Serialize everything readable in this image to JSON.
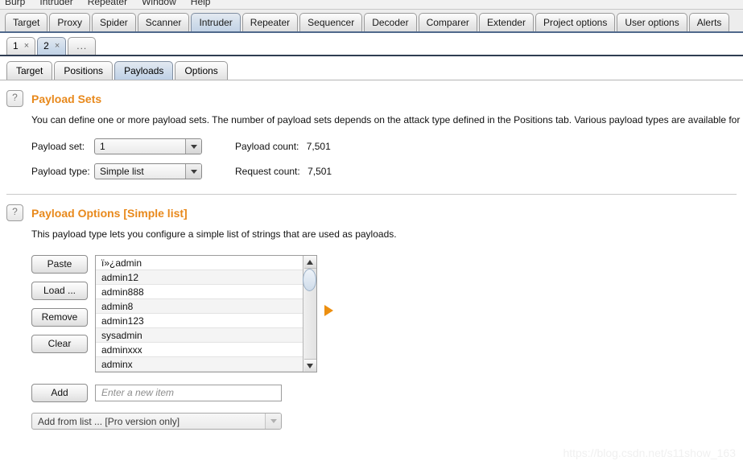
{
  "menu": {
    "items": [
      "Burp",
      "Intruder",
      "Repeater",
      "Window",
      "Help"
    ]
  },
  "main_tabs": {
    "items": [
      {
        "label": "Target",
        "active": false
      },
      {
        "label": "Proxy",
        "active": false
      },
      {
        "label": "Spider",
        "active": false
      },
      {
        "label": "Scanner",
        "active": false
      },
      {
        "label": "Intruder",
        "active": true
      },
      {
        "label": "Repeater",
        "active": false
      },
      {
        "label": "Sequencer",
        "active": false
      },
      {
        "label": "Decoder",
        "active": false
      },
      {
        "label": "Comparer",
        "active": false
      },
      {
        "label": "Extender",
        "active": false
      },
      {
        "label": "Project options",
        "active": false
      },
      {
        "label": "User options",
        "active": false
      },
      {
        "label": "Alerts",
        "active": false
      }
    ]
  },
  "attack_tabs": {
    "items": [
      {
        "label": "1",
        "close": "×",
        "active": false
      },
      {
        "label": "2",
        "close": "×",
        "active": true
      }
    ],
    "more_label": "..."
  },
  "sub_tabs": {
    "items": [
      {
        "label": "Target",
        "active": false
      },
      {
        "label": "Positions",
        "active": false
      },
      {
        "label": "Payloads",
        "active": true
      },
      {
        "label": "Options",
        "active": false
      }
    ]
  },
  "payload_sets": {
    "help_glyph": "?",
    "title": "Payload Sets",
    "description": "You can define one or more payload sets. The number of payload sets depends on the attack type defined in the Positions tab. Various payload types are available for each payload se",
    "payload_set_label": "Payload set:",
    "payload_set_value": "1",
    "payload_type_label": "Payload type:",
    "payload_type_value": "Simple list",
    "payload_count_label": "Payload count:",
    "payload_count_value": "7,501",
    "request_count_label": "Request count:",
    "request_count_value": "7,501"
  },
  "payload_options": {
    "help_glyph": "?",
    "title": "Payload Options [Simple list]",
    "description": "This payload type lets you configure a simple list of strings that are used as payloads.",
    "buttons": [
      {
        "label": "Paste"
      },
      {
        "label": "Load ..."
      },
      {
        "label": "Remove"
      },
      {
        "label": "Clear"
      }
    ],
    "list_items": [
      "ï»¿admin",
      "admin12",
      "admin888",
      "admin8",
      "admin123",
      "sysadmin",
      "adminxxx",
      "adminx"
    ],
    "add_button_label": "Add",
    "add_input_placeholder": "Enter a new item",
    "add_from_list_label": "Add from list ... [Pro version only]"
  },
  "watermark": {
    "text": "https://blog.csdn.net/s11show_163"
  },
  "colors": {
    "accent_orange": "#e8891c",
    "marker_orange": "#ec8f10",
    "active_tab_blue": "#cfdcea",
    "tabstrip_underline": "#50698c"
  }
}
